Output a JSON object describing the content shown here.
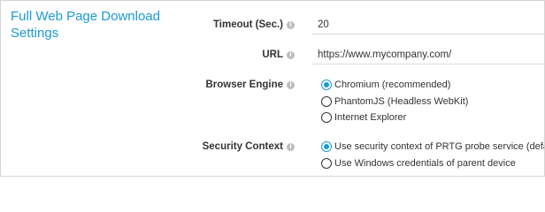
{
  "section": {
    "title": "Full Web Page Download Settings"
  },
  "fields": {
    "timeout": {
      "label": "Timeout (Sec.)",
      "value": "20"
    },
    "url": {
      "label": "URL",
      "value": "https://www.mycompany.com/"
    },
    "browser_engine": {
      "label": "Browser Engine",
      "options": [
        {
          "label": "Chromium (recommended)",
          "selected": true
        },
        {
          "label": "PhantomJS (Headless WebKit)",
          "selected": false
        },
        {
          "label": "Internet Explorer",
          "selected": false
        }
      ]
    },
    "security_context": {
      "label": "Security Context",
      "options": [
        {
          "label": "Use security context of PRTG probe service (default)",
          "selected": true
        },
        {
          "label": "Use Windows credentials of parent device",
          "selected": false
        }
      ]
    }
  },
  "icons": {
    "help": "info-icon"
  },
  "colors": {
    "accent": "#1a9ad6",
    "label_text": "#333333",
    "help_icon": "#bdbdbd"
  }
}
